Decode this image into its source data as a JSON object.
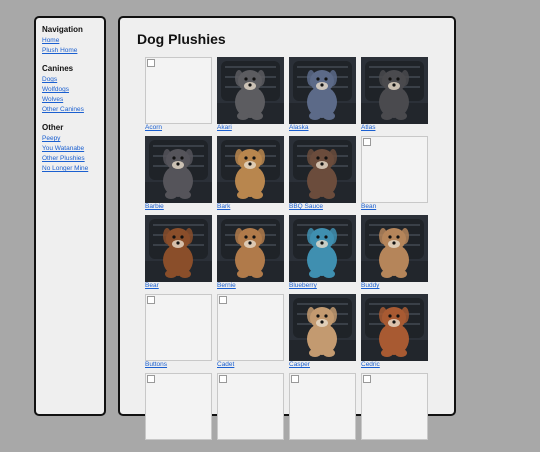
{
  "sidebar": {
    "groups": [
      {
        "heading": "Navigation",
        "links": [
          "Home",
          "Plush Home"
        ]
      },
      {
        "heading": "Canines",
        "links": [
          "Dogs",
          "Wolfdogs",
          "Wolves",
          "Other Canines"
        ]
      },
      {
        "heading": "Other",
        "links": [
          "Peepy",
          "You Watanabe",
          "Other Plushies",
          "No Longer Mine"
        ]
      }
    ]
  },
  "main": {
    "title": "Dog Plushies",
    "items": [
      {
        "name": "Acorn",
        "photo": false
      },
      {
        "name": "Akari",
        "photo": true,
        "color": "#5c5c60"
      },
      {
        "name": "Alaska",
        "photo": true,
        "color": "#5c6a88"
      },
      {
        "name": "Atlas",
        "photo": true,
        "color": "#4a4a4e"
      },
      {
        "name": "Barbie",
        "photo": true,
        "color": "#55545a"
      },
      {
        "name": "Bark",
        "photo": true,
        "color": "#b8864e"
      },
      {
        "name": "BBQ Sauce",
        "photo": true,
        "color": "#6b4c3c"
      },
      {
        "name": "Bean",
        "photo": false
      },
      {
        "name": "Bear",
        "photo": true,
        "color": "#8a4e2a"
      },
      {
        "name": "Bernie",
        "photo": true,
        "color": "#b07a4a"
      },
      {
        "name": "Blueberry",
        "photo": true,
        "color": "#3f8fb0"
      },
      {
        "name": "Buddy",
        "photo": true,
        "color": "#b5855a"
      },
      {
        "name": "Buttons",
        "photo": false
      },
      {
        "name": "Cadet",
        "photo": false
      },
      {
        "name": "Casper",
        "photo": true,
        "color": "#c39a70"
      },
      {
        "name": "Cedric",
        "photo": true,
        "color": "#a85a32"
      },
      {
        "name": "",
        "photo": false
      },
      {
        "name": "",
        "photo": false
      },
      {
        "name": "",
        "photo": false
      },
      {
        "name": "",
        "photo": false
      }
    ]
  }
}
